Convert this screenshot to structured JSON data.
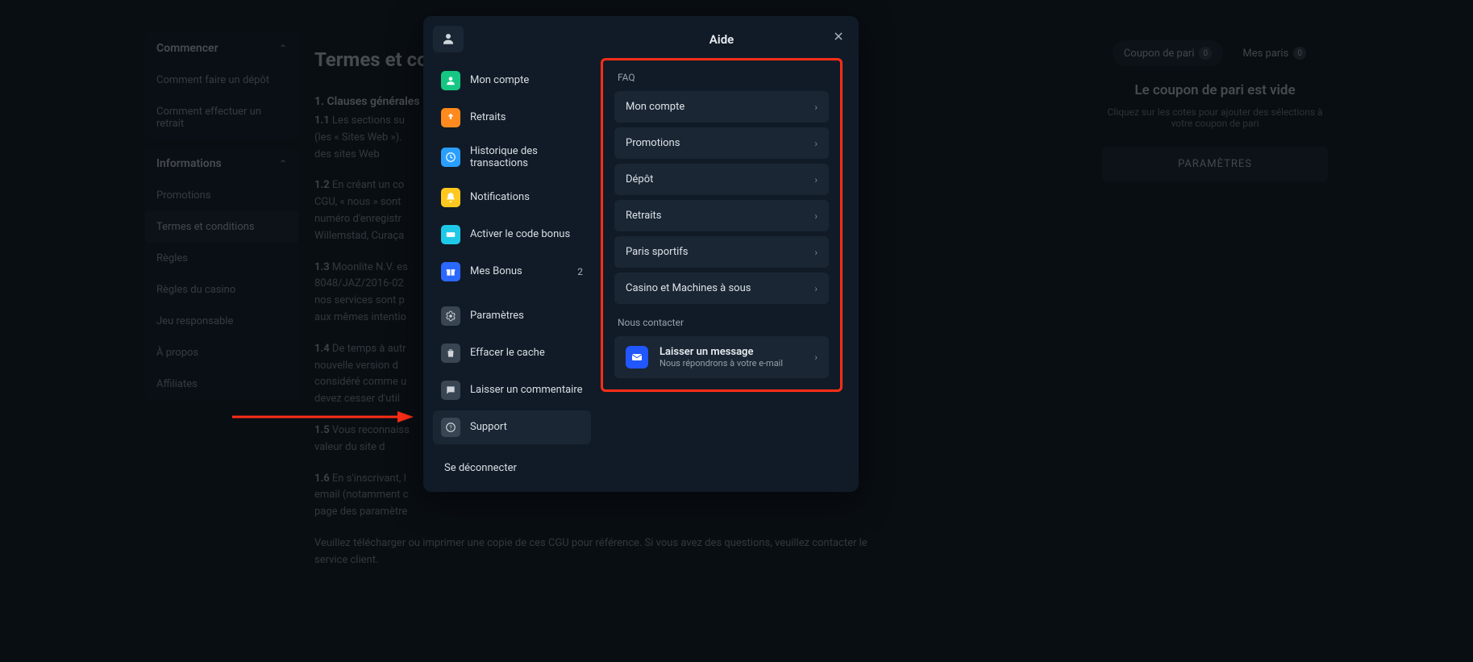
{
  "sidebar": {
    "section1": {
      "title": "Commencer",
      "items": [
        "Comment faire un dépôt",
        "Comment effectuer un retrait"
      ]
    },
    "section2": {
      "title": "Informations",
      "items": [
        "Promotions",
        "Termes et conditions",
        "Règles",
        "Règles du casino",
        "Jeu responsable",
        "À propos",
        "Affiliates"
      ],
      "activeIndex": 1
    }
  },
  "main": {
    "title": "Termes et co",
    "clauses_title": "1. Clauses générales",
    "p11": "Les sections su",
    "p11b": "(les « Sites Web »).",
    "p11c": "des sites Web",
    "p12": "En créant un co",
    "p12b": "CGU, « nous » sont",
    "p12c": "numéro d'enregistr",
    "p12d": "Willemstad, Curaça",
    "p13": "Moonlite N.V. es",
    "p13b": "8048/JAZ/2016-02",
    "p13c": "nos services sont p",
    "p13d": "aux mêmes intentio",
    "p14": "De temps à autr",
    "p14b": "nouvelle version d",
    "p14c": "considéré comme u",
    "p14d": "devez cesser d'util",
    "p15": "Vous reconnaiss",
    "p15b": "valeur du site d",
    "p16": "En s'inscrivant, l",
    "p16b": "email (notamment c",
    "p16c": "page des paramètre",
    "footer": "Veuillez télécharger ou imprimer une copie de ces CGU pour référence. Si vous avez des questions, veuillez contacter le service client."
  },
  "rightcol": {
    "tab1": "Coupon de pari",
    "tab1_badge": "0",
    "tab2": "Mes paris",
    "tab2_badge": "0",
    "empty_title": "Le coupon de pari est vide",
    "empty_sub": "Cliquez sur les cotes pour ajouter des sélections à votre coupon de pari",
    "button": "PARAMÈTRES"
  },
  "modal": {
    "title": "Aide",
    "menu": {
      "account": "Mon compte",
      "withdrawals": "Retraits",
      "history": "Historique des transactions",
      "notifications": "Notifications",
      "bonus_code": "Activer le code bonus",
      "my_bonus": "Mes Bonus",
      "my_bonus_count": "2",
      "settings": "Paramètres",
      "clear_cache": "Effacer le cache",
      "comment": "Laisser un commentaire",
      "support": "Support",
      "logout": "Se déconnecter"
    },
    "faq_label": "FAQ",
    "faq": [
      "Mon compte",
      "Promotions",
      "Dépôt",
      "Retraits",
      "Paris sportifs",
      "Casino et Machines à sous"
    ],
    "contact_label": "Nous contacter",
    "contact_title": "Laisser un message",
    "contact_sub": "Nous répondrons à votre e-mail"
  },
  "colors": {
    "accent": "#2a68ff",
    "warn": "#ff9f1c"
  }
}
